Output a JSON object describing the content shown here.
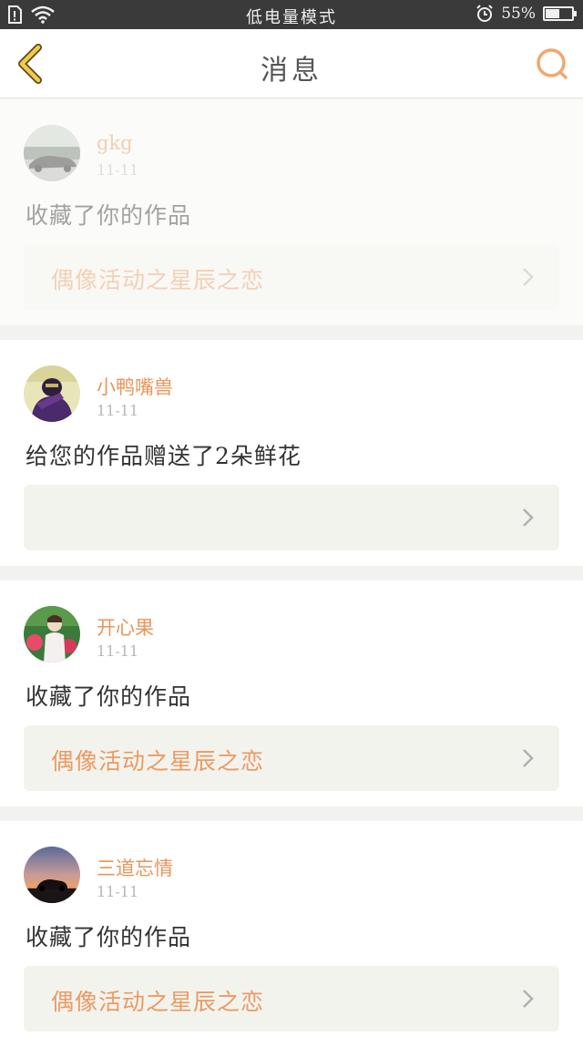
{
  "status_bar": {
    "mode_text": "低电量模式",
    "battery_text": "55%",
    "battery_level": 0.55
  },
  "nav": {
    "title": "消息"
  },
  "messages": [
    {
      "user": "gkg",
      "date": "11-11",
      "text": "收藏了你的作品",
      "link": "偶像活动之星辰之恋",
      "avatar": "car-photo-avatar",
      "faded": true
    },
    {
      "user": "小鸭嘴兽",
      "date": "11-11",
      "text": "给您的作品赠送了2朵鲜花",
      "link": "",
      "avatar": "purple-figure-avatar",
      "faded": false
    },
    {
      "user": "开心果",
      "date": "11-11",
      "text": "收藏了你的作品",
      "link": "偶像活动之星辰之恋",
      "avatar": "girl-photo-avatar",
      "faded": false
    },
    {
      "user": "三道忘情",
      "date": "11-11",
      "text": "收藏了你的作品",
      "link": "偶像活动之星辰之恋",
      "avatar": "sunset-car-avatar",
      "faded": false
    }
  ],
  "colors": {
    "accent": "#e8955a",
    "back_arrow": "#f2c94c",
    "status_bar_bg": "#3a3a3a"
  }
}
